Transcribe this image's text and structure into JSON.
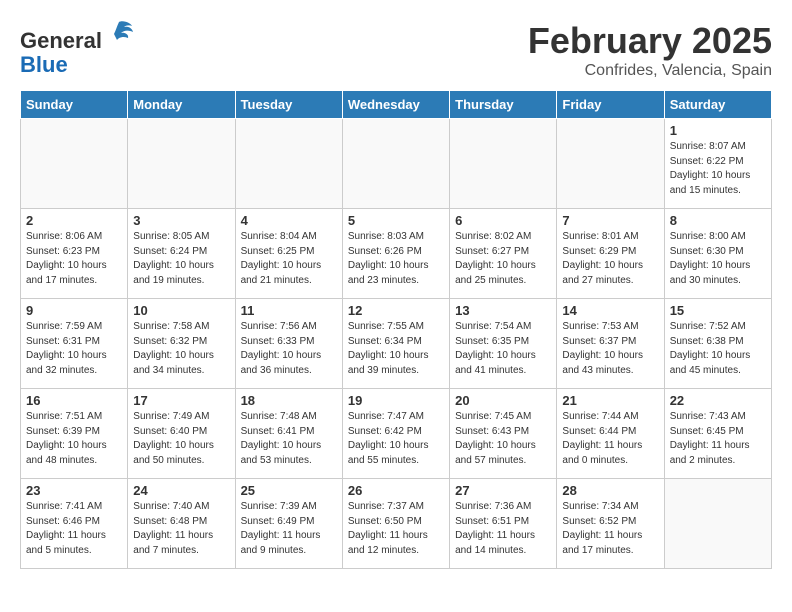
{
  "header": {
    "logo_general": "General",
    "logo_blue": "Blue",
    "title": "February 2025",
    "subtitle": "Confrides, Valencia, Spain"
  },
  "weekdays": [
    "Sunday",
    "Monday",
    "Tuesday",
    "Wednesday",
    "Thursday",
    "Friday",
    "Saturday"
  ],
  "weeks": [
    [
      {
        "day": "",
        "info": ""
      },
      {
        "day": "",
        "info": ""
      },
      {
        "day": "",
        "info": ""
      },
      {
        "day": "",
        "info": ""
      },
      {
        "day": "",
        "info": ""
      },
      {
        "day": "",
        "info": ""
      },
      {
        "day": "1",
        "info": "Sunrise: 8:07 AM\nSunset: 6:22 PM\nDaylight: 10 hours\nand 15 minutes."
      }
    ],
    [
      {
        "day": "2",
        "info": "Sunrise: 8:06 AM\nSunset: 6:23 PM\nDaylight: 10 hours\nand 17 minutes."
      },
      {
        "day": "3",
        "info": "Sunrise: 8:05 AM\nSunset: 6:24 PM\nDaylight: 10 hours\nand 19 minutes."
      },
      {
        "day": "4",
        "info": "Sunrise: 8:04 AM\nSunset: 6:25 PM\nDaylight: 10 hours\nand 21 minutes."
      },
      {
        "day": "5",
        "info": "Sunrise: 8:03 AM\nSunset: 6:26 PM\nDaylight: 10 hours\nand 23 minutes."
      },
      {
        "day": "6",
        "info": "Sunrise: 8:02 AM\nSunset: 6:27 PM\nDaylight: 10 hours\nand 25 minutes."
      },
      {
        "day": "7",
        "info": "Sunrise: 8:01 AM\nSunset: 6:29 PM\nDaylight: 10 hours\nand 27 minutes."
      },
      {
        "day": "8",
        "info": "Sunrise: 8:00 AM\nSunset: 6:30 PM\nDaylight: 10 hours\nand 30 minutes."
      }
    ],
    [
      {
        "day": "9",
        "info": "Sunrise: 7:59 AM\nSunset: 6:31 PM\nDaylight: 10 hours\nand 32 minutes."
      },
      {
        "day": "10",
        "info": "Sunrise: 7:58 AM\nSunset: 6:32 PM\nDaylight: 10 hours\nand 34 minutes."
      },
      {
        "day": "11",
        "info": "Sunrise: 7:56 AM\nSunset: 6:33 PM\nDaylight: 10 hours\nand 36 minutes."
      },
      {
        "day": "12",
        "info": "Sunrise: 7:55 AM\nSunset: 6:34 PM\nDaylight: 10 hours\nand 39 minutes."
      },
      {
        "day": "13",
        "info": "Sunrise: 7:54 AM\nSunset: 6:35 PM\nDaylight: 10 hours\nand 41 minutes."
      },
      {
        "day": "14",
        "info": "Sunrise: 7:53 AM\nSunset: 6:37 PM\nDaylight: 10 hours\nand 43 minutes."
      },
      {
        "day": "15",
        "info": "Sunrise: 7:52 AM\nSunset: 6:38 PM\nDaylight: 10 hours\nand 45 minutes."
      }
    ],
    [
      {
        "day": "16",
        "info": "Sunrise: 7:51 AM\nSunset: 6:39 PM\nDaylight: 10 hours\nand 48 minutes."
      },
      {
        "day": "17",
        "info": "Sunrise: 7:49 AM\nSunset: 6:40 PM\nDaylight: 10 hours\nand 50 minutes."
      },
      {
        "day": "18",
        "info": "Sunrise: 7:48 AM\nSunset: 6:41 PM\nDaylight: 10 hours\nand 53 minutes."
      },
      {
        "day": "19",
        "info": "Sunrise: 7:47 AM\nSunset: 6:42 PM\nDaylight: 10 hours\nand 55 minutes."
      },
      {
        "day": "20",
        "info": "Sunrise: 7:45 AM\nSunset: 6:43 PM\nDaylight: 10 hours\nand 57 minutes."
      },
      {
        "day": "21",
        "info": "Sunrise: 7:44 AM\nSunset: 6:44 PM\nDaylight: 11 hours\nand 0 minutes."
      },
      {
        "day": "22",
        "info": "Sunrise: 7:43 AM\nSunset: 6:45 PM\nDaylight: 11 hours\nand 2 minutes."
      }
    ],
    [
      {
        "day": "23",
        "info": "Sunrise: 7:41 AM\nSunset: 6:46 PM\nDaylight: 11 hours\nand 5 minutes."
      },
      {
        "day": "24",
        "info": "Sunrise: 7:40 AM\nSunset: 6:48 PM\nDaylight: 11 hours\nand 7 minutes."
      },
      {
        "day": "25",
        "info": "Sunrise: 7:39 AM\nSunset: 6:49 PM\nDaylight: 11 hours\nand 9 minutes."
      },
      {
        "day": "26",
        "info": "Sunrise: 7:37 AM\nSunset: 6:50 PM\nDaylight: 11 hours\nand 12 minutes."
      },
      {
        "day": "27",
        "info": "Sunrise: 7:36 AM\nSunset: 6:51 PM\nDaylight: 11 hours\nand 14 minutes."
      },
      {
        "day": "28",
        "info": "Sunrise: 7:34 AM\nSunset: 6:52 PM\nDaylight: 11 hours\nand 17 minutes."
      },
      {
        "day": "",
        "info": ""
      }
    ]
  ]
}
